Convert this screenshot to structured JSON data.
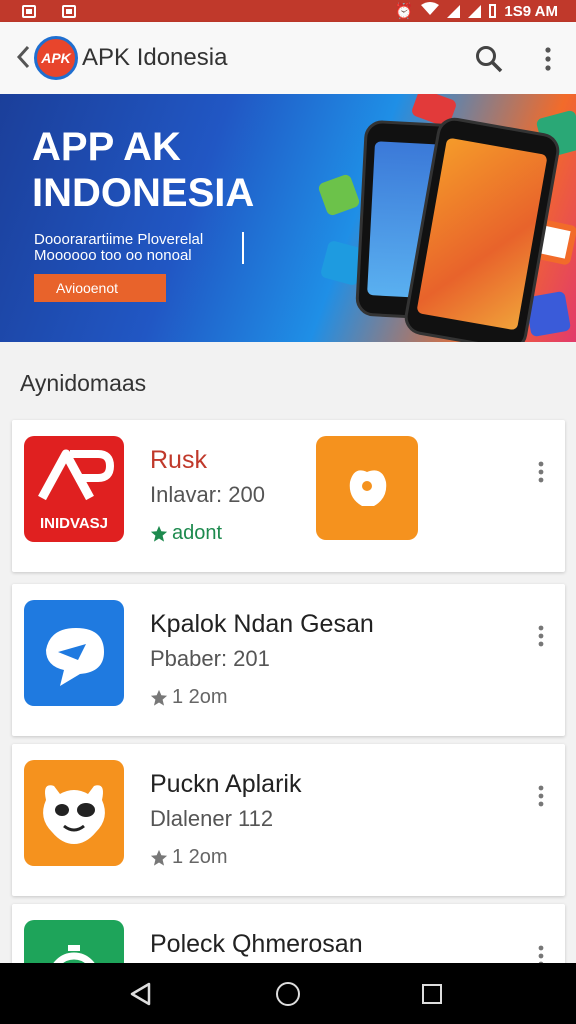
{
  "status_bar": {
    "time": "1S9 AM"
  },
  "app_bar": {
    "title": "APK Idonesia",
    "logo_text": "APK"
  },
  "banner": {
    "title": "APP AK INDONESIA",
    "description": "Dooorarartiime Ploverelal Moooooo too oo nonoal",
    "button_label": "Aviooenot"
  },
  "section": {
    "title": "Aynidomaas"
  },
  "apps": [
    {
      "title": "Rusk",
      "subtitle": "Inlavar: 200",
      "rating": "adont",
      "icon_text": "INIDVASJ",
      "title_color": "#c0392b",
      "rating_color": "#1d8a4e"
    },
    {
      "title": "Kpalok Ndan Gesan",
      "subtitle": "Pbaber: 201",
      "rating": "1 2om",
      "title_color": "#222222",
      "rating_color": "#666666"
    },
    {
      "title": "Puckn Aplarik",
      "subtitle": "Dlalener 112",
      "rating": "1 2om",
      "title_color": "#222222",
      "rating_color": "#666666"
    },
    {
      "title": "Poleck Qhmerosan",
      "subtitle": "",
      "rating": "",
      "title_color": "#222222",
      "rating_color": "#666666"
    }
  ],
  "colors": {
    "accent": "#c0392b",
    "brand_blue": "#1f6fd0"
  }
}
